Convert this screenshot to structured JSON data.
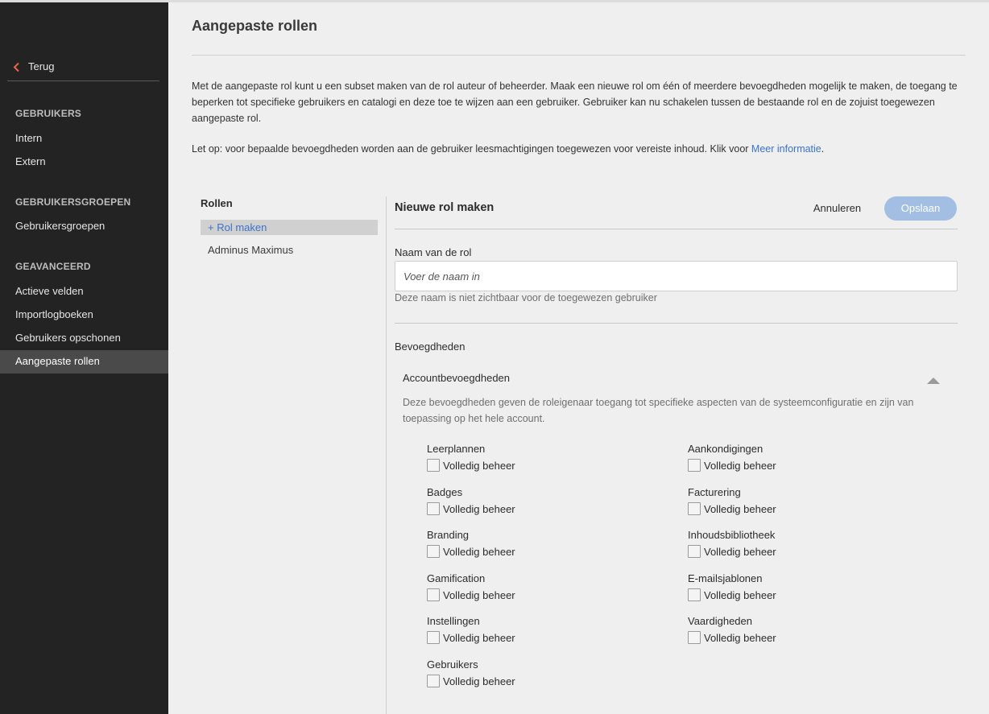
{
  "sidebar": {
    "back_label": "Terug",
    "sections": [
      {
        "title": "GEBRUIKERS",
        "items": [
          "Intern",
          "Extern"
        ]
      },
      {
        "title": "GEBRUIKERSGROEPEN",
        "items": [
          "Gebruikersgroepen"
        ]
      },
      {
        "title": "GEAVANCEERD",
        "items": [
          "Actieve velden",
          "Importlogboeken",
          "Gebruikers opschonen",
          "Aangepaste rollen"
        ]
      }
    ],
    "active_item": "Aangepaste rollen"
  },
  "main": {
    "title": "Aangepaste rollen",
    "intro": "Met de aangepaste rol kunt u een subset maken van de rol auteur of beheerder. Maak een nieuwe rol om één of meerdere bevoegdheden mogelijk te maken, de toegang te beperken tot specifieke gebruikers en catalogi en deze toe te wijzen aan een gebruiker. Gebruiker kan nu schakelen tussen de bestaande rol en de zojuist toegewezen aangepaste rol.",
    "note_prefix": "Let op: voor bepaalde bevoegdheden worden aan de gebruiker leesmachtigingen toegewezen voor vereiste inhoud. Klik voor ",
    "note_link": "Meer informatie",
    "note_suffix": "."
  },
  "roles": {
    "heading": "Rollen",
    "create_label": "+ Rol maken",
    "items": [
      "Adminus Maximus"
    ]
  },
  "form": {
    "title": "Nieuwe rol maken",
    "cancel_label": "Annuleren",
    "save_label": "Opslaan",
    "name_label": "Naam van de rol",
    "name_placeholder": "Voer de naam in",
    "name_value": "",
    "name_helper": "Deze naam is niet zichtbaar voor de toegewezen gebruiker",
    "permissions_heading": "Bevoegdheden",
    "account": {
      "title": "Accountbevoegdheden",
      "description": "Deze bevoegdheden geven de roleigenaar toegang tot specifieke aspecten van de systeemconfiguratie en zijn van toepassing op het hele account.",
      "option_label": "Volledig beheer",
      "left_column": [
        {
          "name": "Leerplannen",
          "checked": false
        },
        {
          "name": "Badges",
          "checked": false
        },
        {
          "name": "Branding",
          "checked": false
        },
        {
          "name": "Gamification",
          "checked": false
        },
        {
          "name": "Instellingen",
          "checked": false
        },
        {
          "name": "Gebruikers",
          "checked": false
        }
      ],
      "right_column": [
        {
          "name": "Aankondigingen",
          "checked": false
        },
        {
          "name": "Facturering",
          "checked": false
        },
        {
          "name": "Inhoudsbibliotheek",
          "checked": false
        },
        {
          "name": "E-mailsjablonen",
          "checked": false
        },
        {
          "name": "Vaardigheden",
          "checked": false
        }
      ]
    }
  },
  "colors": {
    "sidebar_bg": "#232323",
    "active_item_bg": "#4a4a4a",
    "link": "#3b73c9",
    "save_button": "#a2bfe3",
    "back_chevron": "#e8654a"
  }
}
